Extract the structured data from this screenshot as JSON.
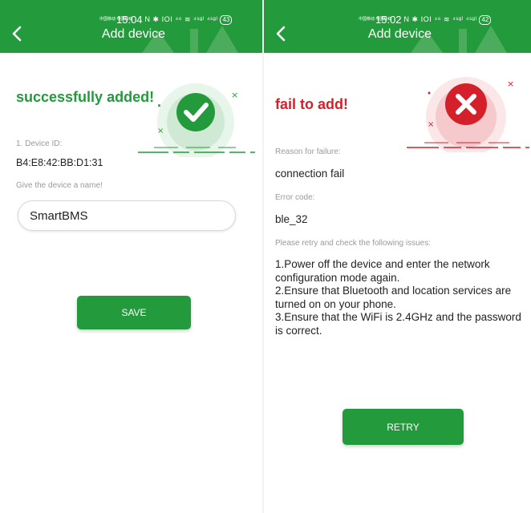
{
  "colors": {
    "green": "#239a3b",
    "red": "#d4202a",
    "gray_label": "#9a9a9a"
  },
  "left": {
    "status": {
      "carrier": "中国移动 中国移动",
      "time": "15:04",
      "sys_icons": "N ✱ ⅠOⅠ ⁴⁶ ≋ ⁴ˢᵍˡ ⁴ˢᵍˡ",
      "battery": "43"
    },
    "header": {
      "title": "Add device",
      "back_icon": "chevron-left-icon"
    },
    "result_title": "successfully added!",
    "result_dot": ".",
    "device_id_label": "1. Device ID:",
    "device_id": "B4:E8:42:BB:D1:31",
    "name_label": "Give the device a name!",
    "name_value": "SmartBMS",
    "save_label": "SAVE",
    "status_icon": "check-circle-icon"
  },
  "right": {
    "status": {
      "carrier": "中国移动 中国移动",
      "time": "15:02",
      "sys_icons": "N ✱ ⅠOⅠ ⁴⁶ ≋ ⁴ˢᵍˡ ⁴ˢᵍˡ",
      "battery": "42"
    },
    "header": {
      "title": "Add device",
      "back_icon": "chevron-left-icon"
    },
    "result_title": "fail to add!",
    "reason_label": "Reason for failure:",
    "reason": "connection fail",
    "error_code_label": "Error code:",
    "error_code": "ble_32",
    "retry_hint": "Please retry and check the following issues:",
    "issues": [
      "1.Power off the device and enter the network configuration mode again.",
      "2.Ensure that Bluetooth and location services are turned on on your phone.",
      "3.Ensure that the WiFi is 2.4GHz and the password is correct."
    ],
    "retry_label": "RETRY",
    "status_icon": "x-circle-icon"
  }
}
